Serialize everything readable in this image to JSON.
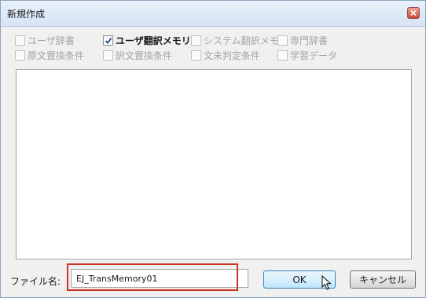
{
  "dialog": {
    "title": "新規作成",
    "close_icon": "close-icon"
  },
  "options": {
    "row1": [
      {
        "label": "ユーザ辞書",
        "checked": false,
        "enabled": false
      },
      {
        "label": "ユーザ翻訳メモリ",
        "checked": true,
        "enabled": true
      },
      {
        "label": "システム翻訳メモリ",
        "checked": false,
        "enabled": false
      },
      {
        "label": "専門辞書",
        "checked": false,
        "enabled": false
      }
    ],
    "row2": [
      {
        "label": "原文置換条件",
        "checked": false,
        "enabled": false
      },
      {
        "label": "訳文置換条件",
        "checked": false,
        "enabled": false
      },
      {
        "label": "文末判定条件",
        "checked": false,
        "enabled": false
      },
      {
        "label": "学習データ",
        "checked": false,
        "enabled": false
      }
    ]
  },
  "file": {
    "label": "ファイル名:",
    "value": "EJ_TransMemory01"
  },
  "buttons": {
    "ok": "OK",
    "cancel": "キャンセル"
  },
  "colors": {
    "highlight": "#cc3322",
    "ok_border": "#3c7fb1"
  }
}
